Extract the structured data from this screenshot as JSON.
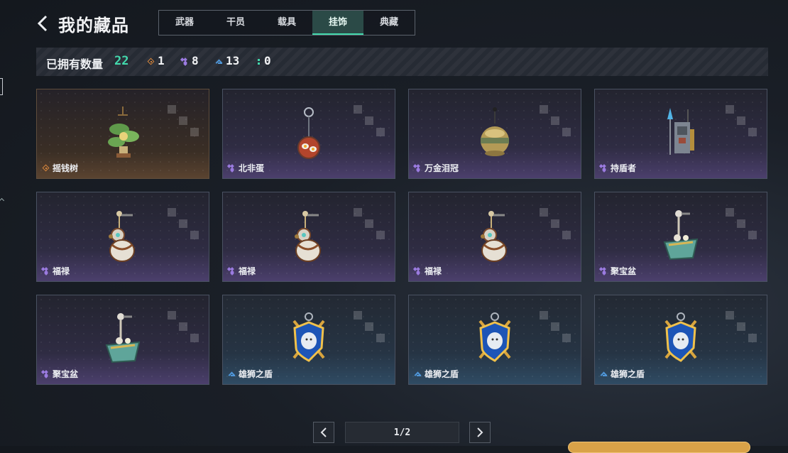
{
  "header": {
    "title": "我的藏品"
  },
  "tabs": [
    {
      "label": "武器",
      "active": false
    },
    {
      "label": "干员",
      "active": false
    },
    {
      "label": "载具",
      "active": false
    },
    {
      "label": "挂饰",
      "active": true
    },
    {
      "label": "典藏",
      "active": false
    }
  ],
  "stats": {
    "label": "已拥有数量",
    "total": "22",
    "counts": [
      {
        "rarity": "orange",
        "value": "1"
      },
      {
        "rarity": "purple",
        "value": "8"
      },
      {
        "rarity": "blue",
        "value": "13"
      },
      {
        "rarity": "green",
        "value": "0"
      }
    ]
  },
  "colors": {
    "accent": "#43d9ad",
    "orange": "#d4843c",
    "purple": "#9b7be0",
    "blue": "#4f96d8",
    "green": "#43d9ad"
  },
  "items": [
    {
      "name": "摇钱树",
      "rarity": "orange",
      "icon": "money-tree-charm"
    },
    {
      "name": "北非蛋",
      "rarity": "purple",
      "icon": "shakshuka-charm"
    },
    {
      "name": "万金泪冠",
      "rarity": "purple",
      "icon": "golden-crown-orb-charm"
    },
    {
      "name": "持盾者",
      "rarity": "purple",
      "icon": "shield-bearer-charm"
    },
    {
      "name": "福禄",
      "rarity": "purple",
      "icon": "gourd-charm"
    },
    {
      "name": "福禄",
      "rarity": "purple",
      "icon": "gourd-charm"
    },
    {
      "name": "福禄",
      "rarity": "purple",
      "icon": "gourd-charm"
    },
    {
      "name": "聚宝盆",
      "rarity": "purple",
      "icon": "treasure-bowl-charm"
    },
    {
      "name": "聚宝盆",
      "rarity": "purple",
      "icon": "treasure-bowl-charm"
    },
    {
      "name": "雄狮之盾",
      "rarity": "blue",
      "icon": "lion-shield-charm"
    },
    {
      "name": "雄狮之盾",
      "rarity": "blue",
      "icon": "lion-shield-charm"
    },
    {
      "name": "雄狮之盾",
      "rarity": "blue",
      "icon": "lion-shield-charm"
    }
  ],
  "pagination": {
    "label": "1/2"
  }
}
